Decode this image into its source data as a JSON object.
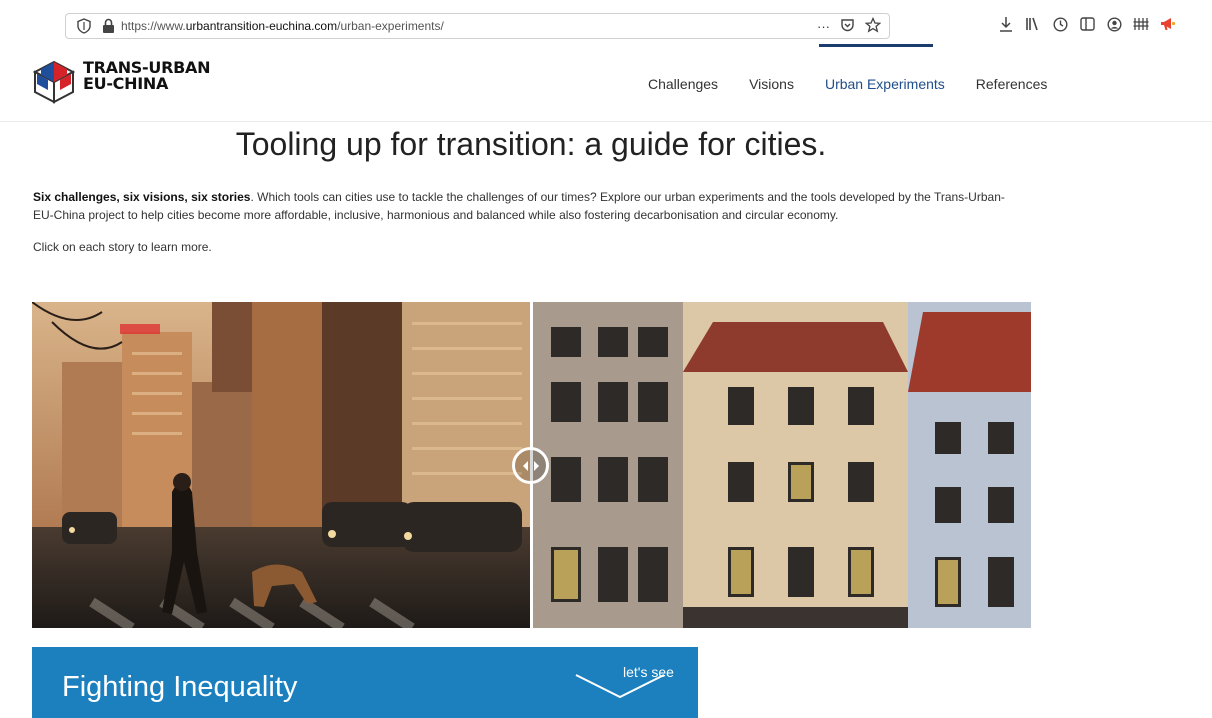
{
  "browser": {
    "url_prefix": "https://www.",
    "url_domain": "urbantransition-euchina.com",
    "url_path": "/urban-experiments/",
    "more_actions": "···",
    "icons": [
      "shield-icon",
      "lock-icon",
      "pocket-icon",
      "bookmark-star-icon",
      "download-icon",
      "library-icon",
      "history-icon",
      "sidebar-icon",
      "account-icon",
      "extensions-icon",
      "megaphone-icon"
    ]
  },
  "header": {
    "logo_line1": "TRANS-URBAN",
    "logo_line2": "EU-CHINA",
    "nav": [
      {
        "label": "Challenges",
        "active": false
      },
      {
        "label": "Visions",
        "active": false
      },
      {
        "label": "Urban Experiments",
        "active": true
      },
      {
        "label": "References",
        "active": false
      }
    ]
  },
  "main": {
    "title": "Tooling up for transition: a guide for cities.",
    "intro_bold": "Six challenges, six visions, six stories",
    "intro_rest": ". Which tools can cities use to tackle the challenges of our times? Explore our urban experiments and the tools developed by the Trans-Urban-EU-China project to help cities become more affordable, inclusive, harmonious and balanced while also fostering decarbonisation and circular economy.",
    "click_note": "Click on each story to learn more."
  },
  "comparison": {
    "left_image": "busy city street at sunset with pedestrian walking a dog",
    "right_image": "colourful historic townhouse facades",
    "split_position": 0.5
  },
  "story": {
    "title": "Fighting Inequality",
    "cta": "let's see"
  },
  "colors": {
    "accent": "#1c7fbe",
    "nav_active": "#1f4e8c",
    "nav_indicator": "#1a3d6e"
  }
}
